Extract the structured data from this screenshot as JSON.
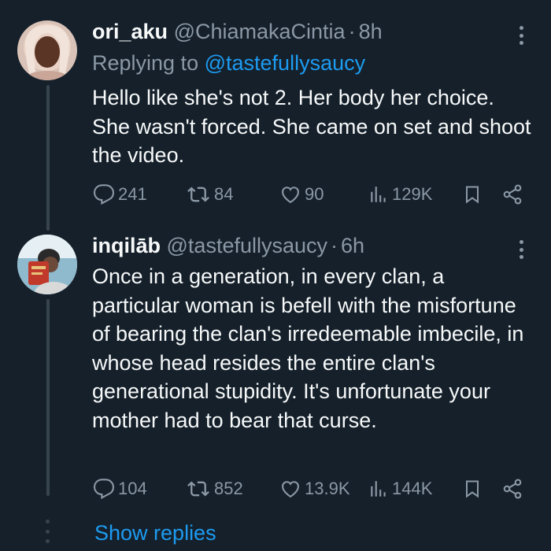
{
  "colors": {
    "background": "#15202b",
    "text_primary": "#f7f9f9",
    "text_secondary": "#8b98a5",
    "accent": "#1d9bf0",
    "thread_line": "#38444d"
  },
  "tweets": [
    {
      "display_name": "ori_aku",
      "handle": "@ChiamakaCintia",
      "separator": "·",
      "time": "8h",
      "replying_prefix": "Replying to",
      "replying_to": "@tastefullysaucy",
      "text": "Hello like she's not 2. Her body her choice. She wasn't forced. She came on set and shoot the video.",
      "actions": {
        "replies": "241",
        "retweets": "84",
        "likes": "90",
        "views": "129K"
      }
    },
    {
      "display_name": "inqilāb",
      "handle": "@tastefullysaucy",
      "separator": "·",
      "time": "6h",
      "text": "Once in a generation, in every clan, a particular woman is befell with the misfortune of bearing the clan's irredeemable imbecile, in whose head resides the entire clan's generational stupidity. It's unfortunate your mother had to bear that curse.",
      "actions": {
        "replies": "104",
        "retweets": "852",
        "likes": "13.9K",
        "views": "144K"
      }
    }
  ],
  "show_replies_label": "Show replies",
  "icons": [
    "reply-icon",
    "retweet-icon",
    "like-icon",
    "views-icon",
    "bookmark-icon",
    "share-icon",
    "more-icon"
  ]
}
